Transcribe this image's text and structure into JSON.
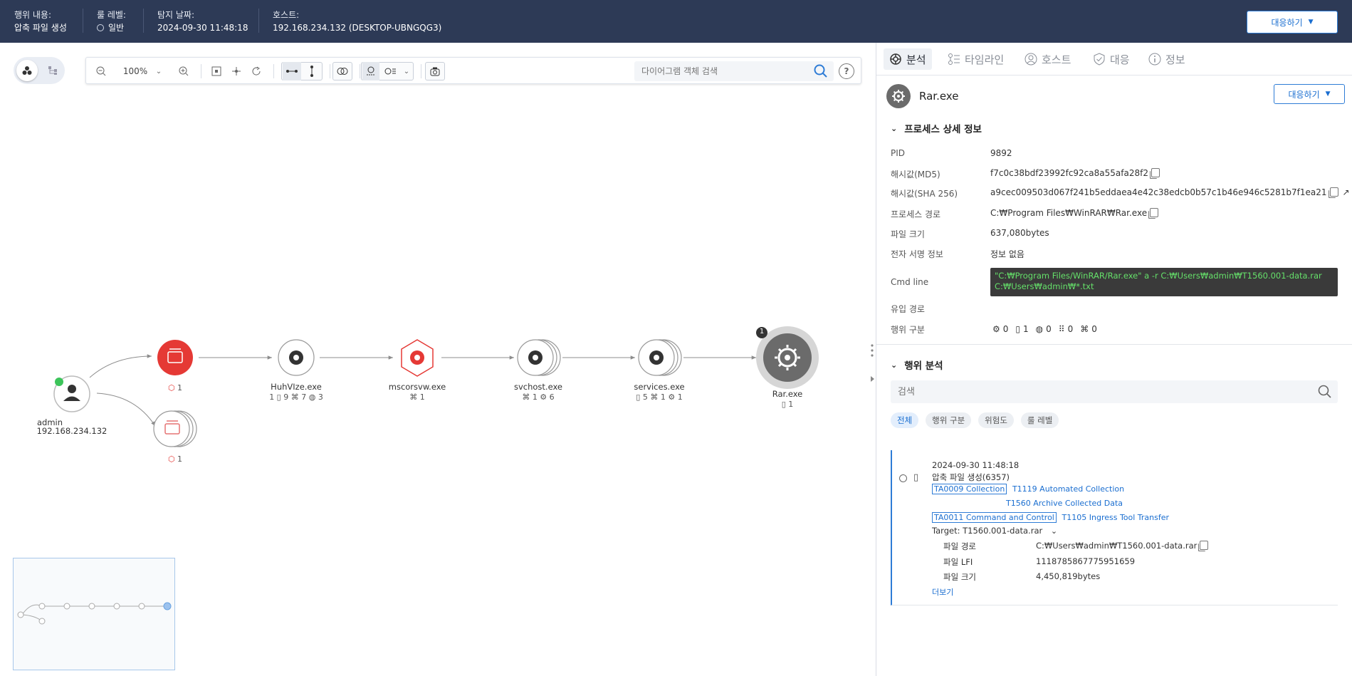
{
  "header": {
    "behavior_label": "행위 내용:",
    "behavior_value": "압축 파일 생성",
    "rule_label": "룰 레벨:",
    "rule_value": "일반",
    "date_label": "탐지 날짜:",
    "date_value": "2024-09-30 11:48:18",
    "host_label": "호스트:",
    "host_value": "192.168.234.132 (DESKTOP-UBNGQG3)",
    "respond_button": "대응하기"
  },
  "toolbar": {
    "zoom": "100%",
    "search_placeholder": "다이어그램 객체 검색",
    "help": "?"
  },
  "graph": {
    "admin_name": "admin",
    "admin_ip": "192.168.234.132",
    "node1_count": "1",
    "node2_count": "1",
    "rar_badge": "1",
    "nodes": [
      {
        "name": "HuhVIze.exe",
        "stats": "1 ▯ 9 ⌘ 7 ◍ 3"
      },
      {
        "name": "mscorsvw.exe",
        "stats": "⌘ 1"
      },
      {
        "name": "svchost.exe",
        "stats": "⌘ 1 ⚙ 6"
      },
      {
        "name": "services.exe",
        "stats": "▯ 5 ⌘ 1 ⚙ 1"
      },
      {
        "name": "Rar.exe",
        "stats": "▯ 1"
      }
    ]
  },
  "tabs": [
    "분석",
    "타임라인",
    "호스트",
    "대응",
    "정보"
  ],
  "detail": {
    "process_name": "Rar.exe",
    "respond_button": "대응하기",
    "section_title": "프로세스 상세 정보",
    "rows": [
      {
        "key": "PID",
        "value": "9892"
      },
      {
        "key": "해시값(MD5)",
        "value": "f7c0c38bdf23992fc92ca8a55afa28f2"
      },
      {
        "key": "해시값(SHA 256)",
        "value": "a9cec009503d067f241b5eddaea4e42c38edcb0b57c1b46e946c5281b7f1ea21"
      },
      {
        "key": "프로세스 경로",
        "value": "C:₩Program Files₩WinRAR₩Rar.exe"
      },
      {
        "key": "파일 크기",
        "value": "637,080bytes"
      },
      {
        "key": "전자 서명 정보",
        "value": "정보 없음"
      }
    ],
    "cmd_label": "Cmd line",
    "cmd_line1": "\"C:₩Program Files/WinRAR/Rar.exe\"  a -r C:₩Users₩admin₩T1560.001-data.rar",
    "cmd_line2": "C:₩Users₩admin₩*.txt",
    "inflow_label": "유입 경로",
    "behavior_label": "행위 구분",
    "behavior_counts": [
      "0",
      "1",
      "0",
      "0",
      "0"
    ]
  },
  "analysis": {
    "section_title": "행위 분석",
    "search_placeholder": "검색",
    "chips": [
      "전체",
      "행위 구분",
      "위험도",
      "룰 레벨"
    ],
    "event": {
      "time": "2024-09-30 11:48:18",
      "title": "압축 파일 생성(6357)",
      "tactic1": "TA0009 Collection",
      "tech1a": "T1119 Automated Collection",
      "tech1b": "T1560 Archive Collected Data",
      "tactic2": "TA0011 Command and Control",
      "tech2": "T1105 Ingress Tool Transfer",
      "target": "Target: T1560.001-data.rar",
      "file_path_label": "파일 경로",
      "file_path_value": "C:₩Users₩admin₩T1560.001-data.rar",
      "file_lfi_label": "파일 LFI",
      "file_lfi_value": "1118785867775951659",
      "file_size_label": "파일 크기",
      "file_size_value": "4,450,819bytes",
      "more": "더보기"
    }
  },
  "colors": {
    "header_bg": "#2d3a56",
    "accent": "#2e7cd6",
    "alert_red": "#e53935",
    "cmd_text": "#65e06a"
  }
}
